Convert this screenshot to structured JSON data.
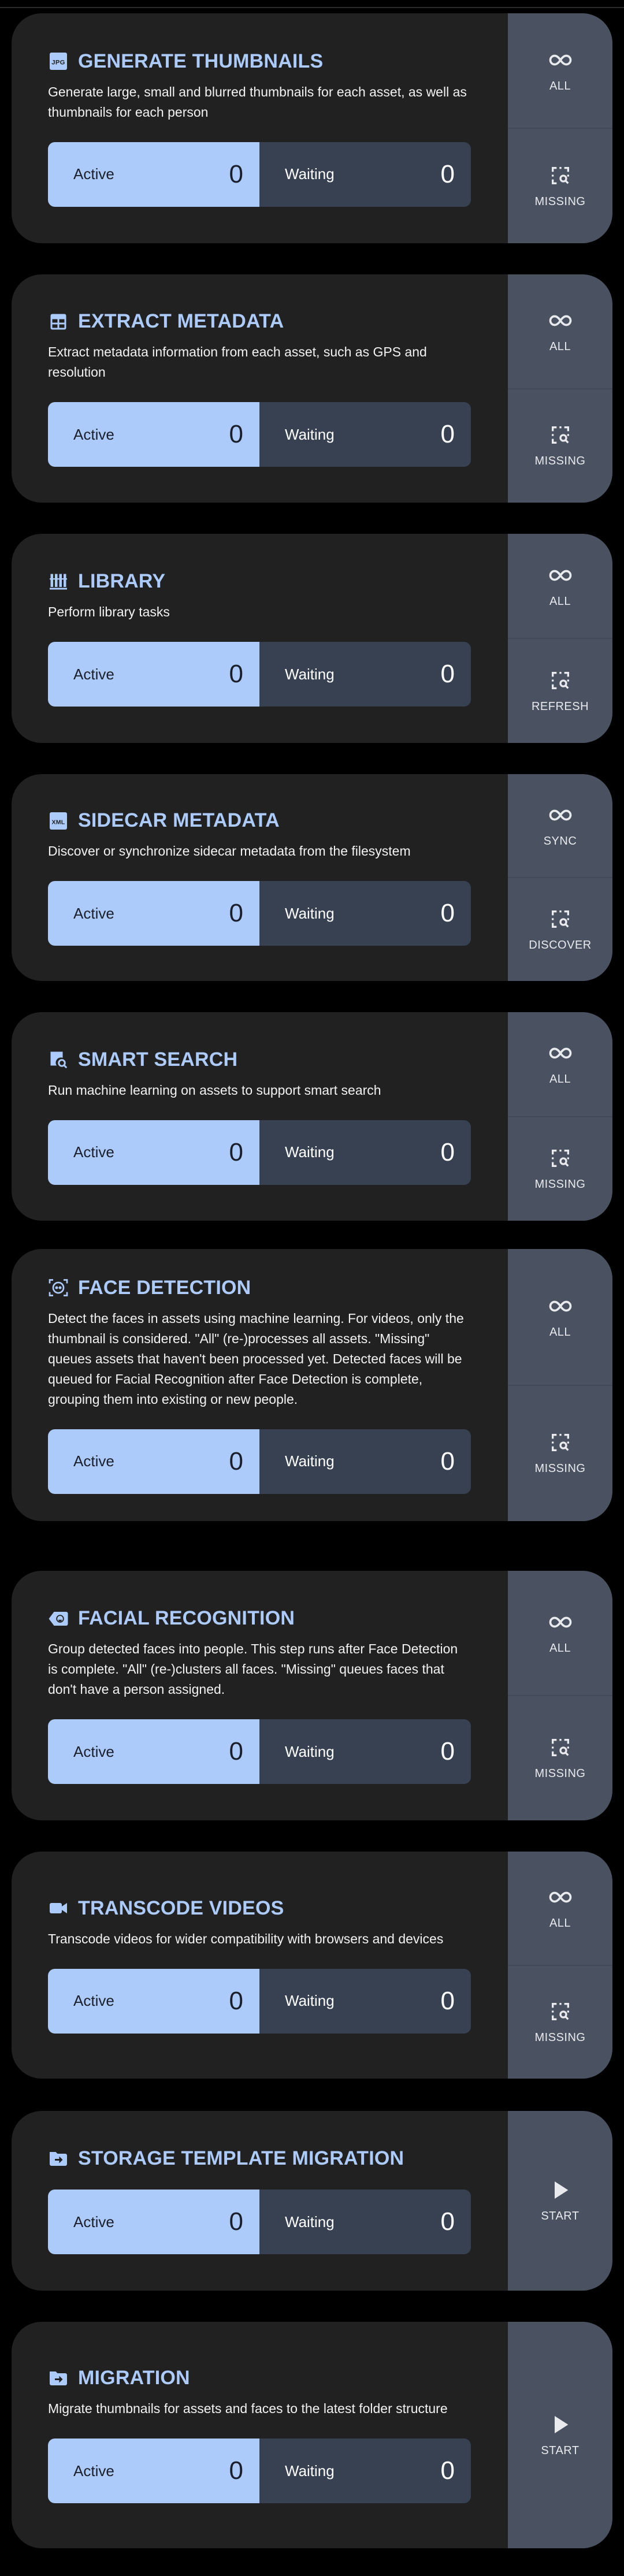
{
  "colors": {
    "accent": "#adcbfa",
    "card": "#212121",
    "side_panel": "#4a5261",
    "waiting": "#374151"
  },
  "jobs": [
    {
      "title": "GENERATE THUMBNAILS",
      "icon": "jpg-file-icon",
      "description": "Generate large, small and blurred thumbnails for each asset, as well as thumbnails for each person",
      "active_label": "Active",
      "active": "0",
      "waiting_label": "Waiting",
      "waiting": "0",
      "buttons": [
        {
          "label": "ALL",
          "icon": "infinity-icon"
        },
        {
          "label": "MISSING",
          "icon": "select-search-icon"
        }
      ]
    },
    {
      "title": "EXTRACT METADATA",
      "icon": "table-icon",
      "description": "Extract metadata information from each asset, such as GPS and resolution",
      "active_label": "Active",
      "active": "0",
      "waiting_label": "Waiting",
      "waiting": "0",
      "buttons": [
        {
          "label": "ALL",
          "icon": "infinity-icon"
        },
        {
          "label": "MISSING",
          "icon": "select-search-icon"
        }
      ]
    },
    {
      "title": "LIBRARY",
      "icon": "library-icon",
      "description": "Perform library tasks",
      "active_label": "Active",
      "active": "0",
      "waiting_label": "Waiting",
      "waiting": "0",
      "buttons": [
        {
          "label": "ALL",
          "icon": "infinity-icon"
        },
        {
          "label": "REFRESH",
          "icon": "select-search-icon"
        }
      ]
    },
    {
      "title": "SIDECAR METADATA",
      "icon": "xml-file-icon",
      "description": "Discover or synchronize sidecar metadata from the filesystem",
      "active_label": "Active",
      "active": "0",
      "waiting_label": "Waiting",
      "waiting": "0",
      "buttons": [
        {
          "label": "SYNC",
          "icon": "infinity-icon"
        },
        {
          "label": "DISCOVER",
          "icon": "select-search-icon"
        }
      ]
    },
    {
      "title": "SMART SEARCH",
      "icon": "image-search-icon",
      "description": "Run machine learning on assets to support smart search",
      "active_label": "Active",
      "active": "0",
      "waiting_label": "Waiting",
      "waiting": "0",
      "buttons": [
        {
          "label": "ALL",
          "icon": "infinity-icon"
        },
        {
          "label": "MISSING",
          "icon": "select-search-icon"
        }
      ]
    },
    {
      "title": "FACE DETECTION",
      "icon": "face-recognition-icon",
      "description": "Detect the faces in assets using machine learning. For videos, only the thumbnail is considered. \"All\" (re-)processes all assets. \"Missing\" queues assets that haven't been processed yet. Detected faces will be queued for Facial Recognition after Face Detection is complete, grouping them into existing or new people.",
      "active_label": "Active",
      "active": "0",
      "waiting_label": "Waiting",
      "waiting": "0",
      "buttons": [
        {
          "label": "ALL",
          "icon": "infinity-icon"
        },
        {
          "label": "MISSING",
          "icon": "select-search-icon"
        }
      ]
    },
    {
      "title": "FACIAL RECOGNITION",
      "icon": "tag-face-icon",
      "description": "Group detected faces into people. This step runs after Face Detection is complete. \"All\" (re-)clusters all faces. \"Missing\" queues faces that don't have a person assigned.",
      "active_label": "Active",
      "active": "0",
      "waiting_label": "Waiting",
      "waiting": "0",
      "buttons": [
        {
          "label": "ALL",
          "icon": "infinity-icon"
        },
        {
          "label": "MISSING",
          "icon": "select-search-icon"
        }
      ]
    },
    {
      "title": "TRANSCODE VIDEOS",
      "icon": "video-icon",
      "description": "Transcode videos for wider compatibility with browsers and devices",
      "active_label": "Active",
      "active": "0",
      "waiting_label": "Waiting",
      "waiting": "0",
      "buttons": [
        {
          "label": "ALL",
          "icon": "infinity-icon"
        },
        {
          "label": "MISSING",
          "icon": "select-search-icon"
        }
      ]
    },
    {
      "title": "STORAGE TEMPLATE MIGRATION",
      "icon": "folder-move-icon",
      "description": "",
      "active_label": "Active",
      "active": "0",
      "waiting_label": "Waiting",
      "waiting": "0",
      "buttons": [
        {
          "label": "START",
          "icon": "play-icon"
        }
      ]
    },
    {
      "title": "MIGRATION",
      "icon": "folder-move-icon",
      "description": "Migrate thumbnails for assets and faces to the latest folder structure",
      "active_label": "Active",
      "active": "0",
      "waiting_label": "Waiting",
      "waiting": "0",
      "buttons": [
        {
          "label": "START",
          "icon": "play-icon"
        }
      ]
    }
  ]
}
